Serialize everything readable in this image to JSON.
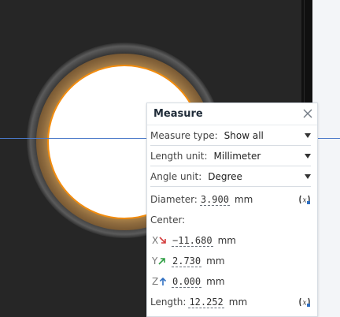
{
  "panel": {
    "title": "Measure",
    "measure_type_label": "Measure type:",
    "measure_type_value": "Show all",
    "length_unit_label": "Length unit:",
    "length_unit_value": "Millimeter",
    "angle_unit_label": "Angle unit:",
    "angle_unit_value": "Degree",
    "diameter_label": "Diameter:",
    "diameter_value": "3.900",
    "diameter_unit": "mm",
    "center_label": "Center:",
    "x_label": "X",
    "x_value": "−11.680",
    "x_unit": "mm",
    "y_label": "Y",
    "y_value": "2.730",
    "y_unit": "mm",
    "z_label": "Z",
    "z_value": "0.000",
    "z_unit": "mm",
    "length_label": "Length:",
    "length_value": "12.252",
    "length_unit": "mm"
  },
  "colors": {
    "edge_highlight": "#f28c0e",
    "axis_line": "#4a79c9",
    "x_arrow": "#d43c3c",
    "y_arrow": "#2f9e44",
    "z_arrow": "#2f6fc1"
  },
  "icons": {
    "close": "close-icon",
    "copy_formula": "copy-variable-icon"
  }
}
